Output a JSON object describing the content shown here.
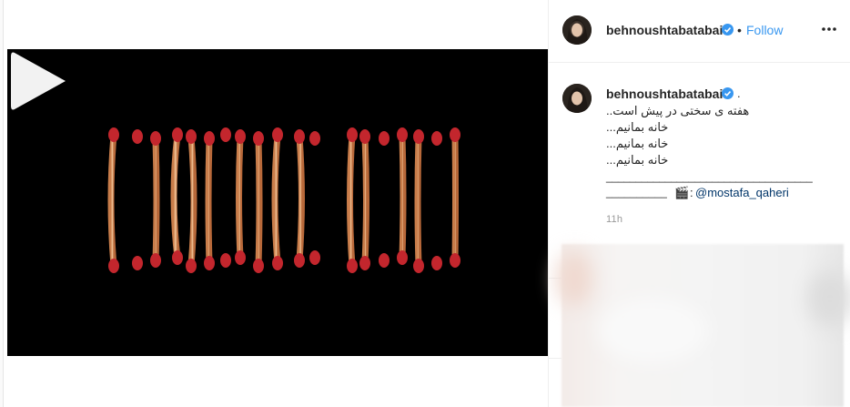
{
  "post": {
    "username": "behnoushtabatabai",
    "separator_dot": "•",
    "follow_label": "Follow",
    "more_icon": "more-options-icon",
    "verified_icon": "verified-badge-icon"
  },
  "caption": {
    "username": "behnoushtabatabai",
    "trailing_dot": ".",
    "lines": [
      "هفته ی سختی در پیش است..",
      "خانه بمانیم...",
      "خانه بمانیم...",
      "خانه بمانیم...",
      "___________________________________",
      "__________"
    ],
    "credit_emoji": "🎬",
    "credit_colon": ":",
    "mention": "@mostafa_qaheri",
    "timestamp": "11h"
  },
  "video": {
    "play_icon": "play-icon"
  },
  "colors": {
    "accent": "#3897f0",
    "verified": "#3897f0",
    "text": "#262626",
    "muted": "#999999"
  }
}
